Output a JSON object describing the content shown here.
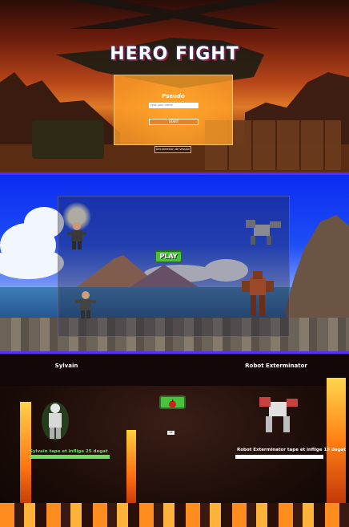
{
  "login": {
    "title": "HERO FIGHT",
    "pseudo_label": "Pseudo",
    "name_placeholder": "type your name",
    "start_label": "START",
    "logout_label": "Deconnexion de session"
  },
  "lobby": {
    "play_label": "PLAY"
  },
  "combat": {
    "player1": {
      "name": "Sylvain",
      "log": "Sylvain tape et inflige 25 degat"
    },
    "player2": {
      "name": "Robot Exterminator",
      "log": "Robot Exterminator tape et inflige 15 degat"
    },
    "badge_label": "ME"
  },
  "colors": {
    "divider": "#5b2cff",
    "play_button": "#49c23c",
    "start_button": "#e8832a",
    "login_box": "#ffa028",
    "lobby_sky": "#0b2cf0",
    "hp_fill": "#6fdc5e"
  },
  "icons": {
    "attack": "apple-icon"
  }
}
